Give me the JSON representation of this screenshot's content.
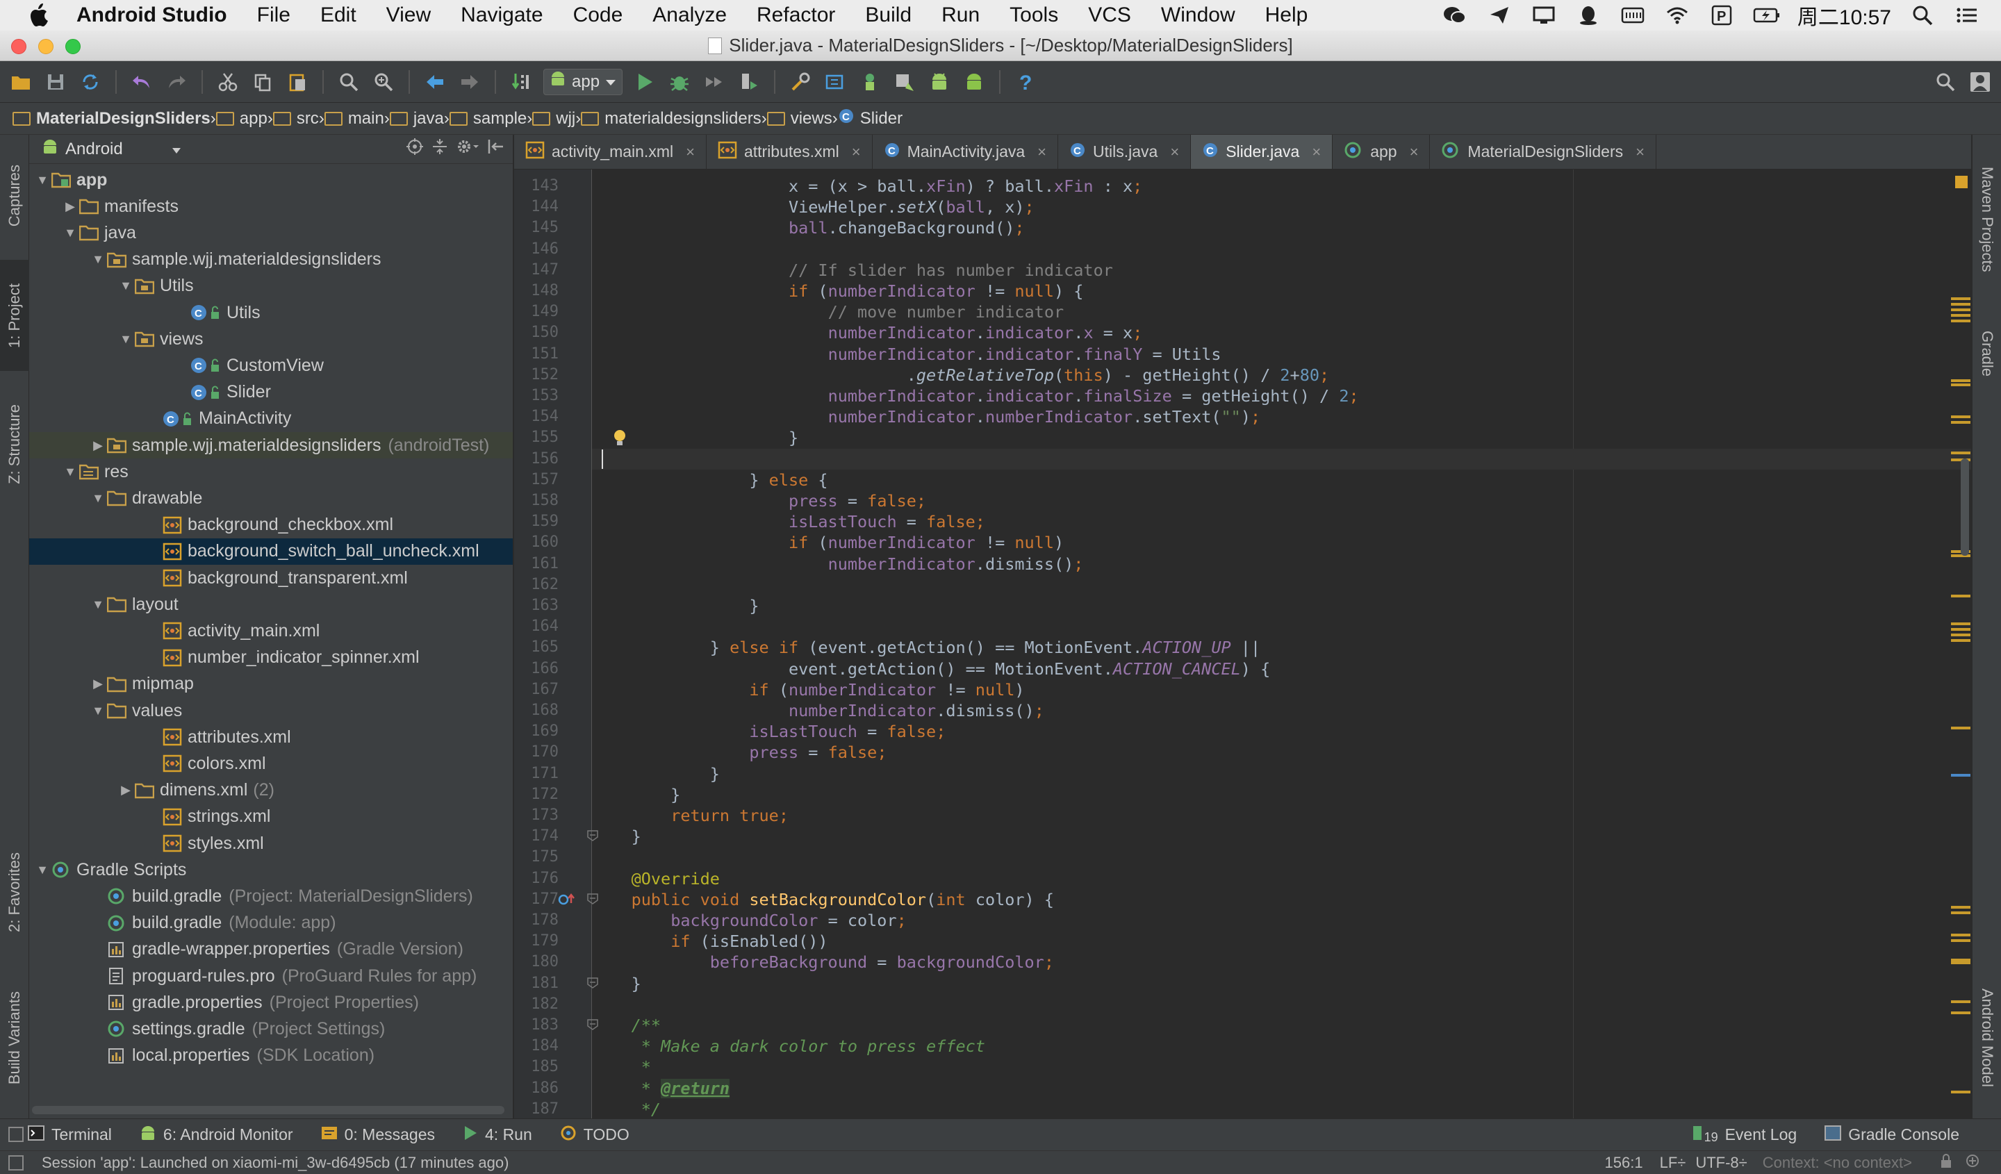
{
  "menubar": {
    "app": "Android Studio",
    "items": [
      "File",
      "Edit",
      "View",
      "Navigate",
      "Code",
      "Analyze",
      "Refactor",
      "Build",
      "Run",
      "Tools",
      "VCS",
      "Window",
      "Help"
    ],
    "clock": "周二10:57"
  },
  "window": {
    "title": "Slider.java - MaterialDesignSliders - [~/Desktop/MaterialDesignSliders]"
  },
  "toolbar": {
    "run_config": "app"
  },
  "breadcrumb": [
    "MaterialDesignSliders",
    "app",
    "src",
    "main",
    "java",
    "sample",
    "wjj",
    "materialdesignsliders",
    "views",
    "Slider"
  ],
  "project": {
    "view_mode": "Android",
    "tree": [
      {
        "label": "app",
        "level": 0,
        "arrow": "down",
        "icon": "module",
        "bold": true
      },
      {
        "label": "manifests",
        "level": 1,
        "arrow": "right",
        "icon": "folder"
      },
      {
        "label": "java",
        "level": 1,
        "arrow": "down",
        "icon": "folder"
      },
      {
        "label": "sample.wjj.materialdesignsliders",
        "level": 2,
        "arrow": "down",
        "icon": "package"
      },
      {
        "label": "Utils",
        "level": 3,
        "arrow": "down",
        "icon": "package"
      },
      {
        "label": "Utils",
        "level": 5,
        "arrow": "",
        "icon": "class"
      },
      {
        "label": "views",
        "level": 3,
        "arrow": "down",
        "icon": "package"
      },
      {
        "label": "CustomView",
        "level": 5,
        "arrow": "",
        "icon": "class"
      },
      {
        "label": "Slider",
        "level": 5,
        "arrow": "",
        "icon": "class"
      },
      {
        "label": "MainActivity",
        "level": 4,
        "arrow": "",
        "icon": "class"
      },
      {
        "label": "sample.wjj.materialdesignsliders",
        "level": 2,
        "arrow": "right",
        "icon": "package",
        "hint": "(androidTest)",
        "highlight": true
      },
      {
        "label": "res",
        "level": 1,
        "arrow": "down",
        "icon": "folder-res"
      },
      {
        "label": "drawable",
        "level": 2,
        "arrow": "down",
        "icon": "folder"
      },
      {
        "label": "background_checkbox.xml",
        "level": 4,
        "arrow": "",
        "icon": "xml"
      },
      {
        "label": "background_switch_ball_uncheck.xml",
        "level": 4,
        "arrow": "",
        "icon": "xml",
        "selected": true
      },
      {
        "label": "background_transparent.xml",
        "level": 4,
        "arrow": "",
        "icon": "xml"
      },
      {
        "label": "layout",
        "level": 2,
        "arrow": "down",
        "icon": "folder"
      },
      {
        "label": "activity_main.xml",
        "level": 4,
        "arrow": "",
        "icon": "xml"
      },
      {
        "label": "number_indicator_spinner.xml",
        "level": 4,
        "arrow": "",
        "icon": "xml"
      },
      {
        "label": "mipmap",
        "level": 2,
        "arrow": "right",
        "icon": "folder"
      },
      {
        "label": "values",
        "level": 2,
        "arrow": "down",
        "icon": "folder"
      },
      {
        "label": "attributes.xml",
        "level": 4,
        "arrow": "",
        "icon": "xml"
      },
      {
        "label": "colors.xml",
        "level": 4,
        "arrow": "",
        "icon": "xml"
      },
      {
        "label": "dimens.xml",
        "level": 3,
        "arrow": "right",
        "icon": "folder",
        "count": "(2)"
      },
      {
        "label": "strings.xml",
        "level": 4,
        "arrow": "",
        "icon": "xml"
      },
      {
        "label": "styles.xml",
        "level": 4,
        "arrow": "",
        "icon": "xml"
      },
      {
        "label": "Gradle Scripts",
        "level": 0,
        "arrow": "down",
        "icon": "gradle"
      },
      {
        "label": "build.gradle",
        "level": 2,
        "arrow": "",
        "icon": "gradle",
        "hint": "(Project: MaterialDesignSliders)"
      },
      {
        "label": "build.gradle",
        "level": 2,
        "arrow": "",
        "icon": "gradle",
        "hint": "(Module: app)"
      },
      {
        "label": "gradle-wrapper.properties",
        "level": 2,
        "arrow": "",
        "icon": "props",
        "hint": "(Gradle Version)"
      },
      {
        "label": "proguard-rules.pro",
        "level": 2,
        "arrow": "",
        "icon": "file",
        "hint": "(ProGuard Rules for app)"
      },
      {
        "label": "gradle.properties",
        "level": 2,
        "arrow": "",
        "icon": "props",
        "hint": "(Project Properties)"
      },
      {
        "label": "settings.gradle",
        "level": 2,
        "arrow": "",
        "icon": "gradle",
        "hint": "(Project Settings)"
      },
      {
        "label": "local.properties",
        "level": 2,
        "arrow": "",
        "icon": "props",
        "hint": "(SDK Location)"
      }
    ]
  },
  "tool_windows": {
    "left": [
      "1: Project",
      "Z: Structure",
      "Captures",
      "2: Favorites",
      "Build Variants"
    ],
    "right": [
      "Maven Projects",
      "Gradle",
      "Android Model"
    ]
  },
  "tabs": [
    {
      "label": "activity_main.xml",
      "icon": "xml"
    },
    {
      "label": "attributes.xml",
      "icon": "xml"
    },
    {
      "label": "MainActivity.java",
      "icon": "class"
    },
    {
      "label": "Utils.java",
      "icon": "class"
    },
    {
      "label": "Slider.java",
      "icon": "class",
      "active": true
    },
    {
      "label": "app",
      "icon": "gradle"
    },
    {
      "label": "MaterialDesignSliders",
      "icon": "gradle"
    }
  ],
  "editor": {
    "current_line": 156,
    "lines": [
      {
        "n": 143,
        "html": "                    x = (x &gt; ball.<span class='f'>xFin</span>) ? ball.<span class='f'>xFin</span> : x<span class='k'>;</span>"
      },
      {
        "n": 144,
        "html": "                    ViewHelper.<span class='i'>setX</span>(<span class='f'>ball</span>, x)<span class='k'>;</span>"
      },
      {
        "n": 145,
        "html": "                    <span class='f'>ball</span>.changeBackground()<span class='k'>;</span>"
      },
      {
        "n": 146,
        "html": ""
      },
      {
        "n": 147,
        "html": "                    <span class='c'>// If slider has number indicator</span>"
      },
      {
        "n": 148,
        "html": "                    <span class='k'>if</span> (<span class='f'>numberIndicator</span> != <span class='k'>null</span>) {"
      },
      {
        "n": 149,
        "html": "                        <span class='c'>// move number indicator</span>"
      },
      {
        "n": 150,
        "html": "                        <span class='f'>numberIndicator</span>.<span class='f'>indicator</span>.<span class='f'>x</span> = x<span class='k'>;</span>"
      },
      {
        "n": 151,
        "html": "                        <span class='f'>numberIndicator</span>.<span class='f'>indicator</span>.<span class='f'>finalY</span> = Utils"
      },
      {
        "n": 152,
        "html": "                                .<span class='i'>getRelativeTop</span>(<span class='k'>this</span>) - getHeight() / <span class='n'>2</span>+<span class='n'>80</span><span class='k'>;</span>"
      },
      {
        "n": 153,
        "html": "                        <span class='f'>numberIndicator</span>.<span class='f'>indicator</span>.<span class='f'>finalSize</span> = getHeight() / <span class='n'>2</span><span class='k'>;</span>"
      },
      {
        "n": 154,
        "html": "                        <span class='f'>numberIndicator</span>.<span class='f'>numberIndicator</span>.setText(<span class='s'>\"\"</span>)<span class='k'>;</span>"
      },
      {
        "n": 155,
        "html": "                    }"
      },
      {
        "n": 156,
        "html": ""
      },
      {
        "n": 157,
        "html": "                } <span class='k'>else</span> {"
      },
      {
        "n": 158,
        "html": "                    <span class='f'>press</span> = <span class='k'>false;</span>"
      },
      {
        "n": 159,
        "html": "                    <span class='f'>isLastTouch</span> = <span class='k'>false;</span>"
      },
      {
        "n": 160,
        "html": "                    <span class='k'>if</span> (<span class='f'>numberIndicator</span> != <span class='k'>null</span>)"
      },
      {
        "n": 161,
        "html": "                        <span class='f'>numberIndicator</span>.dismiss()<span class='k'>;</span>"
      },
      {
        "n": 162,
        "html": ""
      },
      {
        "n": 163,
        "html": "                }"
      },
      {
        "n": 164,
        "html": ""
      },
      {
        "n": 165,
        "html": "            } <span class='k'>else if</span> (event.getAction() == MotionEvent.<span class='f i'>ACTION_UP</span> ||"
      },
      {
        "n": 166,
        "html": "                    event.getAction() == MotionEvent.<span class='f i'>ACTION_CANCEL</span>) {"
      },
      {
        "n": 167,
        "html": "                <span class='k'>if</span> (<span class='f'>numberIndicator</span> != <span class='k'>null</span>)"
      },
      {
        "n": 168,
        "html": "                    <span class='f'>numberIndicator</span>.dismiss()<span class='k'>;</span>"
      },
      {
        "n": 169,
        "html": "                <span class='f'>isLastTouch</span> = <span class='k'>false;</span>"
      },
      {
        "n": 170,
        "html": "                <span class='f'>press</span> = <span class='k'>false;</span>"
      },
      {
        "n": 171,
        "html": "            }"
      },
      {
        "n": 172,
        "html": "        }"
      },
      {
        "n": 173,
        "html": "        <span class='k'>return true;</span>"
      },
      {
        "n": 174,
        "html": "    }"
      },
      {
        "n": 175,
        "html": ""
      },
      {
        "n": 176,
        "html": "    <span class='a'>@Override</span>"
      },
      {
        "n": 177,
        "html": "    <span class='k'>public void</span> <span class='m'>setBackgroundColor</span>(<span class='k'>int</span> color) {"
      },
      {
        "n": 178,
        "html": "        <span class='f'>backgroundColor</span> = color<span class='k'>;</span>"
      },
      {
        "n": 179,
        "html": "        <span class='k'>if</span> (isEnabled())"
      },
      {
        "n": 180,
        "html": "            <span class='f'>beforeBackground</span> = <span class='f'>backgroundColor</span><span class='k'>;</span>"
      },
      {
        "n": 181,
        "html": "    }"
      },
      {
        "n": 182,
        "html": ""
      },
      {
        "n": 183,
        "html": "    <span class='doc'>/**</span>"
      },
      {
        "n": 184,
        "html": "<span class='doc'>     * Make a dark color to press effect</span>"
      },
      {
        "n": 185,
        "html": "<span class='doc'>     *</span>"
      },
      {
        "n": 186,
        "html": "<span class='doc'>     * </span><span class='tag'>@return</span>"
      },
      {
        "n": 187,
        "html": "<span class='doc'>     */</span>"
      }
    ]
  },
  "bottom_tools": [
    {
      "label": "Terminal",
      "icon": "terminal"
    },
    {
      "label": "6: Android Monitor",
      "icon": "android"
    },
    {
      "label": "0: Messages",
      "icon": "messages"
    },
    {
      "label": "4: Run",
      "icon": "run"
    },
    {
      "label": "TODO",
      "icon": "todo"
    }
  ],
  "bottom_right": {
    "event_log": "Event Log",
    "event_count": "19",
    "gradle_console": "Gradle Console"
  },
  "status": {
    "message": "Session 'app': Launched on xiaomi-mi_3w-d6495cb (17 minutes ago)",
    "position": "156:1",
    "line_sep": "LF÷",
    "encoding": "UTF-8÷",
    "context": "Context: <no context>"
  },
  "colors": {
    "accent": "#4a88c7",
    "keyword": "#cc7832",
    "field": "#9876aa",
    "comment": "#808080",
    "method": "#ffc66d",
    "number": "#6897bb",
    "string": "#6a8759",
    "warning": "#d9a22c"
  }
}
